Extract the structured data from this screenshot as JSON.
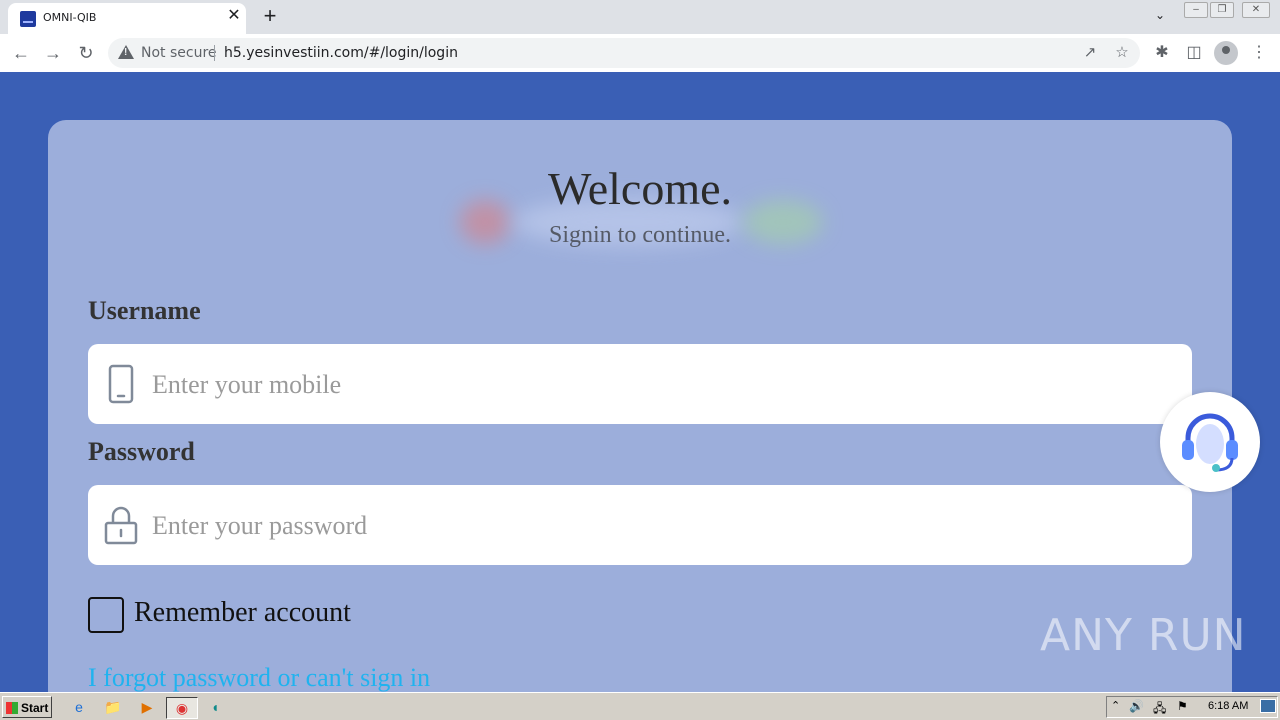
{
  "browser": {
    "tab_title": "OMNI-QIB",
    "tab_close": "✕",
    "new_tab": "+",
    "security_label": "Not secure",
    "url": "h5.yesinvestiin.com/#/login/login"
  },
  "login": {
    "title": "Welcome.",
    "subtitle": "Signin to continue.",
    "username_label": "Username",
    "username_placeholder": "Enter your mobile",
    "password_label": "Password",
    "password_placeholder": "Enter your password",
    "remember_label": "Remember account",
    "forgot_link": "I forgot password or can't sign in"
  },
  "watermark": "ANY RUN",
  "taskbar": {
    "start_label": "Start",
    "clock": "6:18 AM"
  },
  "colors": {
    "page_background": "#3a5fb5",
    "card_background": "#9caedb",
    "link": "#1fb3ef"
  }
}
